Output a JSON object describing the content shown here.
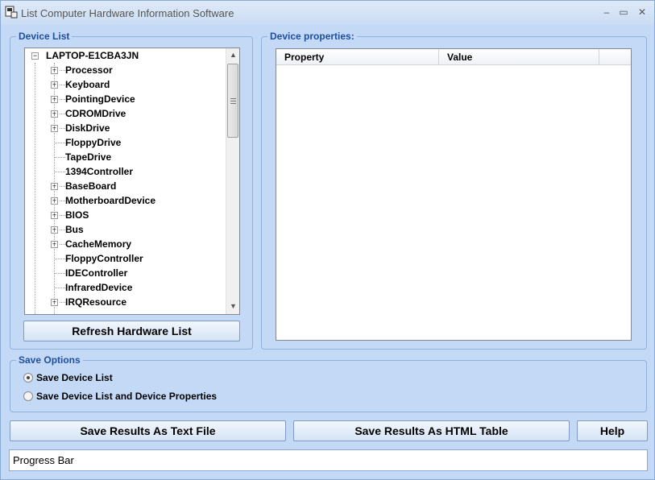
{
  "window": {
    "title": "List Computer Hardware Information Software",
    "minimize_glyph": "–",
    "maximize_glyph": "▭",
    "close_glyph": "✕"
  },
  "device_list": {
    "legend": "Device List",
    "root": "LAPTOP-E1CBA3JN",
    "items": [
      {
        "label": "Processor",
        "expandable": true
      },
      {
        "label": "Keyboard",
        "expandable": true
      },
      {
        "label": "PointingDevice",
        "expandable": true
      },
      {
        "label": "CDROMDrive",
        "expandable": true
      },
      {
        "label": "DiskDrive",
        "expandable": true
      },
      {
        "label": "FloppyDrive",
        "expandable": false
      },
      {
        "label": "TapeDrive",
        "expandable": false
      },
      {
        "label": "1394Controller",
        "expandable": false
      },
      {
        "label": "BaseBoard",
        "expandable": true
      },
      {
        "label": "MotherboardDevice",
        "expandable": true
      },
      {
        "label": "BIOS",
        "expandable": true
      },
      {
        "label": "Bus",
        "expandable": true
      },
      {
        "label": "CacheMemory",
        "expandable": true
      },
      {
        "label": "FloppyController",
        "expandable": false
      },
      {
        "label": "IDEController",
        "expandable": false
      },
      {
        "label": "InfraredDevice",
        "expandable": false
      },
      {
        "label": "IRQResource",
        "expandable": true
      }
    ],
    "refresh_label": "Refresh Hardware List"
  },
  "device_properties": {
    "legend": "Device properties:",
    "columns": [
      "Property",
      "Value"
    ]
  },
  "save_options": {
    "legend": "Save Options",
    "options": [
      {
        "label": "Save Device List",
        "checked": true
      },
      {
        "label": "Save Device List and Device Properties",
        "checked": false
      }
    ]
  },
  "buttons": {
    "save_text": "Save Results As Text File",
    "save_html": "Save Results As HTML Table",
    "help": "Help"
  },
  "status": {
    "progress_label": "Progress Bar"
  },
  "colors": {
    "window_bg": "#c3d9f5",
    "legend_text": "#1f4e9c",
    "group_border": "#8fb1de"
  }
}
